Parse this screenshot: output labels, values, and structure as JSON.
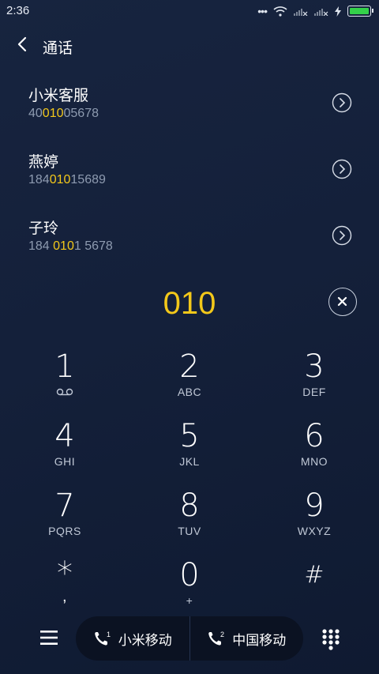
{
  "status_bar": {
    "time": "2:36",
    "more_dots": "•••"
  },
  "header": {
    "title": "通话"
  },
  "contacts": [
    {
      "name": "小米客服",
      "number_pre": "40",
      "number_hl": "010",
      "number_post": "05678"
    },
    {
      "name": "燕婷",
      "number_pre": "184",
      "number_hl": "010",
      "number_post": "15689"
    },
    {
      "name": "子玲",
      "number_pre": "184 ",
      "number_hl": "010",
      "number_post": "1 5678"
    }
  ],
  "dial": {
    "digits": "010"
  },
  "keypad": [
    {
      "num": "1",
      "sub": ""
    },
    {
      "num": "2",
      "sub": "ABC"
    },
    {
      "num": "3",
      "sub": "DEF"
    },
    {
      "num": "4",
      "sub": "GHI"
    },
    {
      "num": "5",
      "sub": "JKL"
    },
    {
      "num": "6",
      "sub": "MNO"
    },
    {
      "num": "7",
      "sub": "PQRS"
    },
    {
      "num": "8",
      "sub": "TUV"
    },
    {
      "num": "9",
      "sub": "WXYZ"
    },
    {
      "num": "*",
      "sub": ","
    },
    {
      "num": "0",
      "sub": "+"
    },
    {
      "num": "#",
      "sub": ""
    }
  ],
  "sims": [
    {
      "slot": "1",
      "label": "小米移动"
    },
    {
      "slot": "2",
      "label": "中国移动"
    }
  ],
  "colors": {
    "accent": "#f3c81a",
    "background": "#15223c",
    "secondary_text": "#8e9bb0"
  }
}
